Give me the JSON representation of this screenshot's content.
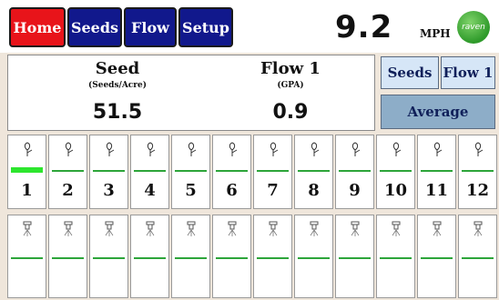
{
  "nav": {
    "home": "Home",
    "seeds": "Seeds",
    "flow": "Flow",
    "setup": "Setup"
  },
  "speed": {
    "value": "9.2",
    "unit": "MPH"
  },
  "logo": {
    "icon": "brand-logo-icon",
    "text": "raven"
  },
  "summary": {
    "seed": {
      "title": "Seed",
      "subtitle": "(Seeds/Acre)",
      "value": "51.5"
    },
    "flow": {
      "title": "Flow 1",
      "subtitle": "(GPA)",
      "value": "0.9"
    }
  },
  "view_toggle": {
    "seeds": "Seeds",
    "flow": "Flow 1",
    "average": "Average"
  },
  "seed_rows": [
    {
      "label": "1",
      "icon": "seed-icon",
      "highlight": true
    },
    {
      "label": "2",
      "icon": "seed-icon",
      "highlight": false
    },
    {
      "label": "3",
      "icon": "seed-icon",
      "highlight": false
    },
    {
      "label": "4",
      "icon": "seed-icon",
      "highlight": false
    },
    {
      "label": "5",
      "icon": "seed-icon",
      "highlight": false
    },
    {
      "label": "6",
      "icon": "seed-icon",
      "highlight": false
    },
    {
      "label": "7",
      "icon": "seed-icon",
      "highlight": false
    },
    {
      "label": "8",
      "icon": "seed-icon",
      "highlight": false
    },
    {
      "label": "9",
      "icon": "seed-icon",
      "highlight": false
    },
    {
      "label": "10",
      "icon": "seed-icon",
      "highlight": false
    },
    {
      "label": "11",
      "icon": "seed-icon",
      "highlight": false
    },
    {
      "label": "12",
      "icon": "seed-icon",
      "highlight": false
    }
  ],
  "flow_rows": [
    {
      "icon": "nozzle-icon"
    },
    {
      "icon": "nozzle-icon"
    },
    {
      "icon": "nozzle-icon"
    },
    {
      "icon": "nozzle-icon"
    },
    {
      "icon": "nozzle-icon"
    },
    {
      "icon": "nozzle-icon"
    },
    {
      "icon": "nozzle-icon"
    },
    {
      "icon": "nozzle-icon"
    },
    {
      "icon": "nozzle-icon"
    },
    {
      "icon": "nozzle-icon"
    },
    {
      "icon": "nozzle-icon"
    },
    {
      "icon": "nozzle-icon"
    }
  ],
  "colors": {
    "home": "#e8141a",
    "nav_blue": "#11188c",
    "status_green": "#2da53a",
    "toggle_bg": "#d6e6f7",
    "average_bg": "#8dadc8"
  }
}
